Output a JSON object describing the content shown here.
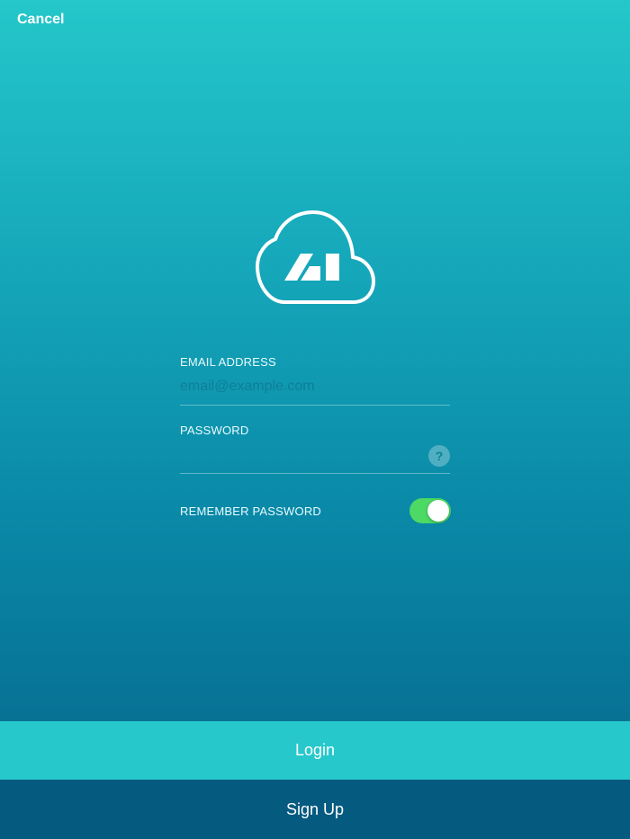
{
  "header": {
    "cancel_label": "Cancel"
  },
  "logo": {
    "icon": "cloud-ai-logo"
  },
  "form": {
    "email": {
      "label": "EMAIL ADDRESS",
      "placeholder": "email@example.com",
      "value": ""
    },
    "password": {
      "label": "PASSWORD",
      "value": "",
      "help_glyph": "?"
    },
    "remember": {
      "label": "REMEMBER PASSWORD",
      "enabled": true
    }
  },
  "actions": {
    "login_label": "Login",
    "signup_label": "Sign Up"
  },
  "colors": {
    "gradient_top": "#24c7ca",
    "gradient_bottom": "#06648a",
    "login_bg": "#27c8cb",
    "signup_bg": "#055a80",
    "toggle_on": "#4cd964"
  }
}
